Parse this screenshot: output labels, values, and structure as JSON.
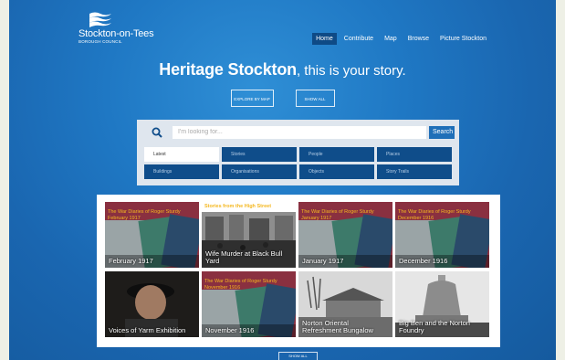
{
  "brand": {
    "name": "Stockton-on-Tees",
    "subtitle": "BOROUGH COUNCIL"
  },
  "nav": {
    "items": [
      {
        "label": "Home",
        "active": true
      },
      {
        "label": "Contribute"
      },
      {
        "label": "Map"
      },
      {
        "label": "Browse"
      },
      {
        "label": "Picture Stockton"
      }
    ]
  },
  "hero": {
    "title": "Heritage Stockton",
    "tagline": ", this is your story.",
    "explore_label": "EXPLORE BY MAP",
    "show_all_label": "SHOW ALL"
  },
  "search": {
    "placeholder": "I'm looking for...",
    "button_label": "Search",
    "categories": [
      {
        "label": "Latest",
        "active": true
      },
      {
        "label": "Stories"
      },
      {
        "label": "People"
      },
      {
        "label": "Places"
      },
      {
        "label": "Buildings"
      },
      {
        "label": "Organisations"
      },
      {
        "label": "Objects"
      },
      {
        "label": "Story Trails"
      }
    ]
  },
  "gallery": {
    "tiles": [
      {
        "caption": "February 1917",
        "banner": "The War Diaries of Roger Sturdy February 1917",
        "art": "diaries"
      },
      {
        "caption": "Wife Murder at Black Bull Yard",
        "banner": "Stories from the High Street",
        "art": "street"
      },
      {
        "caption": "January 1917",
        "banner": "The War Diaries of Roger Sturdy January 1917",
        "art": "diaries"
      },
      {
        "caption": "December 1916",
        "banner": "The War Diaries of Roger Sturdy December 1916",
        "art": "diaries"
      },
      {
        "caption": "Voices of Yarm Exhibition",
        "banner": "",
        "art": "portrait"
      },
      {
        "caption": "November 1916",
        "banner": "The War Diaries of Roger Sturdy November 1916",
        "art": "diaries"
      },
      {
        "caption": "Norton Oriental Refreshment Bungalow",
        "banner": "",
        "art": "bungalow"
      },
      {
        "caption": "Big Ben and the Norton Foundry",
        "banner": "",
        "art": "bell"
      }
    ],
    "show_all_label": "SHOW ALL"
  },
  "colors": {
    "background": "#1f78c4",
    "nav_active": "#0e4a86",
    "category": "#0f4d8a",
    "search_button": "#1f6fb8",
    "banner_text": "#f5b820"
  }
}
